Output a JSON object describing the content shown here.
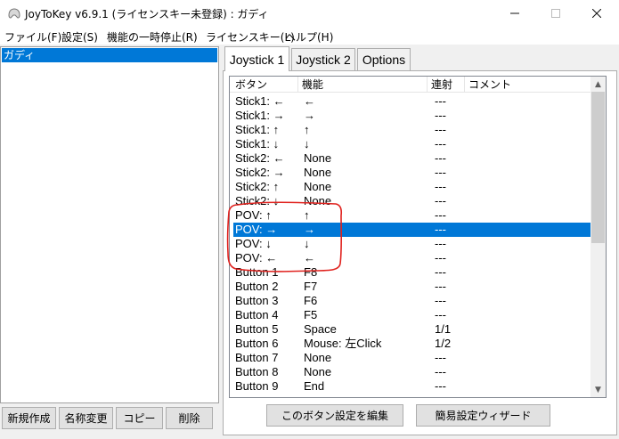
{
  "window": {
    "title": "JoyToKey v6.9.1 (ライセンスキー未登録) : ガディ",
    "minimize_icon": "minimize-icon",
    "maximize_icon": "maximize-icon",
    "close_icon": "close-icon"
  },
  "menu": [
    "ファイル(F)",
    "設定(S)",
    "機能の一時停止(R)",
    "ライセンスキー(L)",
    "ヘルプ(H)"
  ],
  "profiles": {
    "selected": "ガディ"
  },
  "left_buttons": [
    "新規作成",
    "名称変更",
    "コピー",
    "削除"
  ],
  "tabs": [
    "Joystick 1",
    "Joystick 2",
    "Options"
  ],
  "list": {
    "columns": [
      "ボタン",
      "機能",
      "連射",
      "コメント"
    ],
    "rows": [
      {
        "button": "Stick1: ←",
        "function": "←",
        "rapid": "---"
      },
      {
        "button": "Stick1: →",
        "function": "→",
        "rapid": "---"
      },
      {
        "button": "Stick1: ↑",
        "function": "↑",
        "rapid": "---"
      },
      {
        "button": "Stick1: ↓",
        "function": "↓",
        "rapid": "---"
      },
      {
        "button": "Stick2: ←",
        "function": "None",
        "rapid": "---"
      },
      {
        "button": "Stick2: →",
        "function": "None",
        "rapid": "---"
      },
      {
        "button": "Stick2: ↑",
        "function": "None",
        "rapid": "---"
      },
      {
        "button": "Stick2: ↓",
        "function": "None",
        "rapid": "---"
      },
      {
        "button": "POV: ↑",
        "function": "↑",
        "rapid": "---"
      },
      {
        "button": "POV: →",
        "function": "→",
        "rapid": "---",
        "selected": true
      },
      {
        "button": "POV: ↓",
        "function": "↓",
        "rapid": "---"
      },
      {
        "button": "POV: ←",
        "function": "←",
        "rapid": "---"
      },
      {
        "button": "Button 1",
        "function": "F8",
        "rapid": "---"
      },
      {
        "button": "Button 2",
        "function": "F7",
        "rapid": "---"
      },
      {
        "button": "Button 3",
        "function": "F6",
        "rapid": "---"
      },
      {
        "button": "Button 4",
        "function": "F5",
        "rapid": "---"
      },
      {
        "button": "Button 5",
        "function": "Space",
        "rapid": "1/1"
      },
      {
        "button": "Button 6",
        "function": "Mouse: 左Click",
        "rapid": "1/2"
      },
      {
        "button": "Button 7",
        "function": "None",
        "rapid": "---"
      },
      {
        "button": "Button 8",
        "function": "None",
        "rapid": "---"
      },
      {
        "button": "Button 9",
        "function": "End",
        "rapid": "---"
      }
    ]
  },
  "bottom_buttons": [
    "このボタン設定を編集",
    "簡易設定ウィザード"
  ],
  "colors": {
    "selection": "#0078d7",
    "annotation": "#e0221e"
  }
}
